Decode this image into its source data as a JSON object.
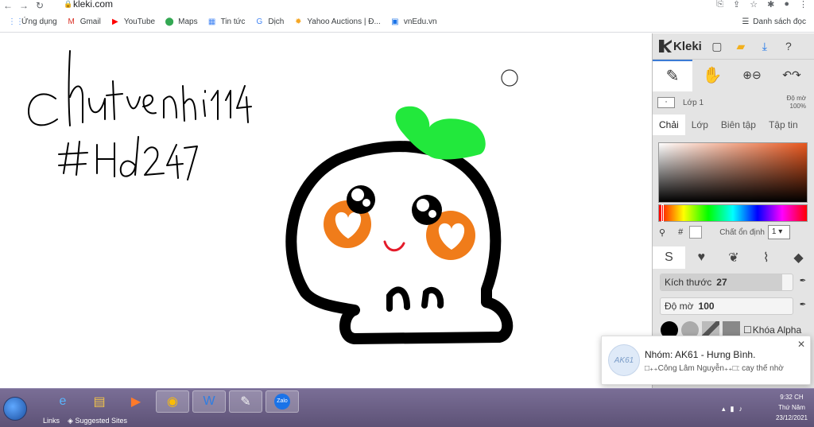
{
  "browser": {
    "url": "kleki.com",
    "bookmarks": [
      {
        "icon": "apps-grid-icon",
        "glyph": "⋮⋮",
        "label": "Ứng dụng",
        "color": "#4285f4"
      },
      {
        "icon": "gmail-icon",
        "glyph": "M",
        "label": "Gmail",
        "color": "#d93025"
      },
      {
        "icon": "youtube-icon",
        "glyph": "▶",
        "label": "YouTube",
        "color": "#ff0000"
      },
      {
        "icon": "maps-icon",
        "glyph": "⬤",
        "label": "Maps",
        "color": "#34a853"
      },
      {
        "icon": "news-icon",
        "glyph": "▦",
        "label": "Tin tức",
        "color": "#4285f4"
      },
      {
        "icon": "translate-icon",
        "glyph": "G",
        "label": "Dịch",
        "color": "#4285f4"
      },
      {
        "icon": "yahoo-icon",
        "glyph": "✹",
        "label": "Yahoo Auctions | Đ...",
        "color": "#f5a623"
      },
      {
        "icon": "vnedu-icon",
        "glyph": "▣",
        "label": "vnEdu.vn",
        "color": "#1a73e8"
      }
    ],
    "reading_list": "Danh sách đọc"
  },
  "canvas": {
    "handwriting_line1": "Chutvenhi114",
    "handwriting_line2": "#Hd247"
  },
  "panel": {
    "app_name": "Kleki",
    "layer_name": "Lớp 1",
    "opacity_label": "Độ mờ",
    "opacity_value": "100%",
    "tabs": [
      {
        "label": "Chải",
        "active": true
      },
      {
        "label": "Lớp",
        "active": false
      },
      {
        "label": "Biên tập",
        "active": false
      },
      {
        "label": "Tập tin",
        "active": false
      }
    ],
    "hash_symbol": "#",
    "stabilizer_label": "Chất ổn định",
    "stabilizer_value": "1",
    "size_label": "Kích thước",
    "size_value": "27",
    "size_fraction": 0.92,
    "opacity_slider_label": "Độ mờ",
    "opacity_slider_value": "100",
    "opacity_fraction": 1.0,
    "lock_alpha_label": "Khóa Alpha"
  },
  "notification": {
    "avatar_text": "AK61",
    "title": "Nhóm: AK61 - Hưng Bình.",
    "message": "□₊₊Công Lâm Nguyễn₊₊□: cay thế nhờ"
  },
  "taskbar": {
    "links_label": "Links",
    "suggested_label": "Suggested Sites",
    "time": "9:32 CH",
    "day": "Thứ Năm",
    "date": "23/12/2021",
    "zalo_label": "Zalo"
  },
  "colors": {
    "accent": "#3b7bd5",
    "leaf_green": "#22e83c",
    "cheek_orange": "#f07c1a",
    "mouth_red": "#e41b2a"
  }
}
